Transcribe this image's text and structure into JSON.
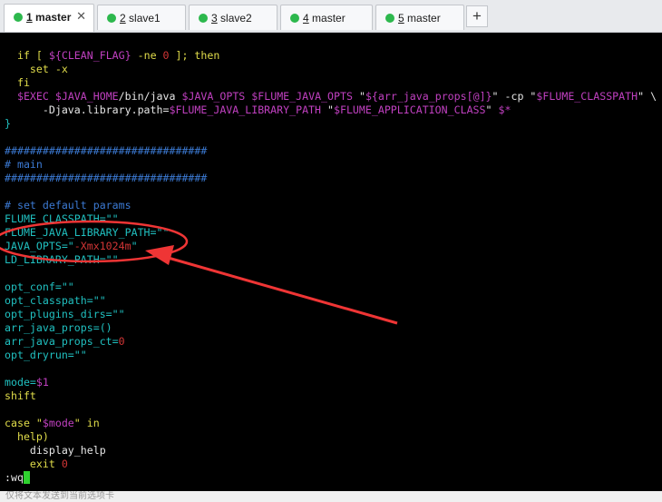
{
  "tabs": [
    {
      "num": "1",
      "name": " master",
      "active": true
    },
    {
      "num": "2",
      "name": " slave1",
      "active": false
    },
    {
      "num": "3",
      "name": " slave2",
      "active": false
    },
    {
      "num": "4",
      "name": " master",
      "active": false
    },
    {
      "num": "5",
      "name": " master",
      "active": false
    }
  ],
  "tab_close": "✕",
  "new_tab": "+",
  "terminal": {
    "lines": [
      [
        {
          "t": "  if [ ",
          "c": "y"
        },
        {
          "t": "${CLEAN_FLAG}",
          "c": "m"
        },
        {
          "t": " -ne ",
          "c": "y"
        },
        {
          "t": "0",
          "c": "r"
        },
        {
          "t": " ]; then",
          "c": "y"
        }
      ],
      [
        {
          "t": "    set -x",
          "c": "y"
        }
      ],
      [
        {
          "t": "  fi",
          "c": "y"
        }
      ],
      [
        {
          "t": "  ",
          "c": "w"
        },
        {
          "t": "$EXEC",
          "c": "m"
        },
        {
          "t": " ",
          "c": "w"
        },
        {
          "t": "$JAVA_HOME",
          "c": "m"
        },
        {
          "t": "/bin/java ",
          "c": "w"
        },
        {
          "t": "$JAVA_OPTS",
          "c": "m"
        },
        {
          "t": " ",
          "c": "w"
        },
        {
          "t": "$FLUME_JAVA_OPTS",
          "c": "m"
        },
        {
          "t": " \"",
          "c": "w"
        },
        {
          "t": "${arr_java_props[@]}",
          "c": "m"
        },
        {
          "t": "\" -cp \"",
          "c": "w"
        },
        {
          "t": "$FLUME_CLASSPATH",
          "c": "m"
        },
        {
          "t": "\" \\",
          "c": "w"
        }
      ],
      [
        {
          "t": "      -Djava.library.path=",
          "c": "w"
        },
        {
          "t": "$FLUME_JAVA_LIBRARY_PATH",
          "c": "m"
        },
        {
          "t": " \"",
          "c": "w"
        },
        {
          "t": "$FLUME_APPLICATION_CLASS",
          "c": "m"
        },
        {
          "t": "\" ",
          "c": "w"
        },
        {
          "t": "$*",
          "c": "m"
        }
      ],
      [
        {
          "t": "}",
          "c": "c"
        }
      ],
      [],
      [
        {
          "t": "################################",
          "c": "b"
        }
      ],
      [
        {
          "t": "# main",
          "c": "b"
        }
      ],
      [
        {
          "t": "################################",
          "c": "b"
        }
      ],
      [],
      [
        {
          "t": "# set default params",
          "c": "b"
        }
      ],
      [
        {
          "t": "FLUME_CLASSPATH=\"\"",
          "c": "c"
        }
      ],
      [
        {
          "t": "FLUME_JAVA_LIBRARY_PATH=\"\"",
          "c": "c"
        }
      ],
      [
        {
          "t": "JAVA_OPTS=\"",
          "c": "c"
        },
        {
          "t": "-Xmx1024m",
          "c": "r"
        },
        {
          "t": "\"",
          "c": "c"
        }
      ],
      [
        {
          "t": "LD_LIBRARY_PATH=\"\"",
          "c": "c"
        }
      ],
      [],
      [
        {
          "t": "opt_conf=\"\"",
          "c": "c"
        }
      ],
      [
        {
          "t": "opt_classpath=\"\"",
          "c": "c"
        }
      ],
      [
        {
          "t": "opt_plugins_dirs=\"\"",
          "c": "c"
        }
      ],
      [
        {
          "t": "arr_java_props=()",
          "c": "c"
        }
      ],
      [
        {
          "t": "arr_java_props_ct=",
          "c": "c"
        },
        {
          "t": "0",
          "c": "r"
        }
      ],
      [
        {
          "t": "opt_dryrun=\"\"",
          "c": "c"
        }
      ],
      [],
      [
        {
          "t": "mode=",
          "c": "c"
        },
        {
          "t": "$1",
          "c": "m"
        }
      ],
      [
        {
          "t": "shift",
          "c": "y"
        }
      ],
      [],
      [
        {
          "t": "case \"",
          "c": "y"
        },
        {
          "t": "$mode",
          "c": "m"
        },
        {
          "t": "\" in",
          "c": "y"
        }
      ],
      [
        {
          "t": "  help)",
          "c": "y"
        }
      ],
      [
        {
          "t": "    display_help",
          "c": "w"
        }
      ],
      [
        {
          "t": "    exit ",
          "c": "y"
        },
        {
          "t": "0",
          "c": "r"
        }
      ],
      [
        {
          "t": ":wq",
          "c": "w"
        },
        {
          "t": "",
          "c": "cursor"
        }
      ]
    ]
  },
  "statusbar": "仅将文本发送到当前选项卡"
}
